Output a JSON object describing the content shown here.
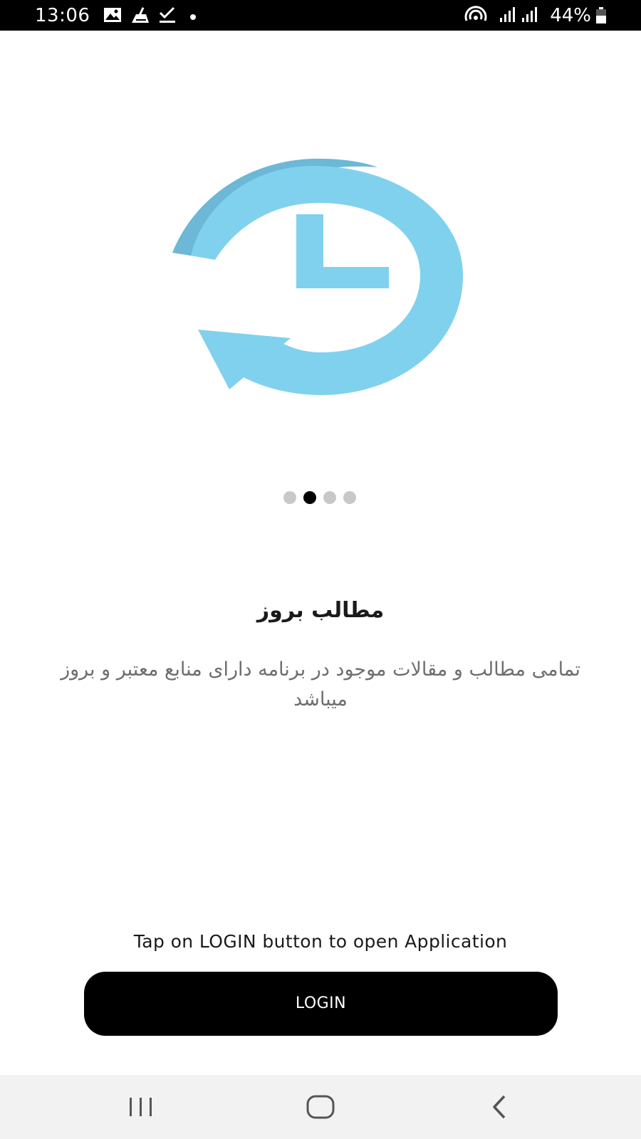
{
  "status_bar": {
    "time": "13:06",
    "battery": "44%",
    "left_icons": [
      "gallery-icon",
      "cleaner-icon",
      "check-icon",
      "dot-icon"
    ],
    "right_icons": [
      "hotspot-icon",
      "signal-icon",
      "signal-icon",
      "battery-icon"
    ]
  },
  "slide": {
    "illustration_icon": "history-clock-icon",
    "illustration_colors": {
      "light": "#80d1ee",
      "dark": "#6cb8d6"
    },
    "title": "مطالب بروز",
    "description": "تمامی مطالب و مقالات موجود در برنامه دارای منابع معتبر و بروز میباشد"
  },
  "pager": {
    "count": 4,
    "active_index": 1
  },
  "footer": {
    "hint": "Tap on LOGIN button to open Application",
    "login_label": "LOGIN"
  },
  "nav_bar": {
    "buttons": [
      "recent-apps-icon",
      "home-icon",
      "back-icon"
    ]
  }
}
